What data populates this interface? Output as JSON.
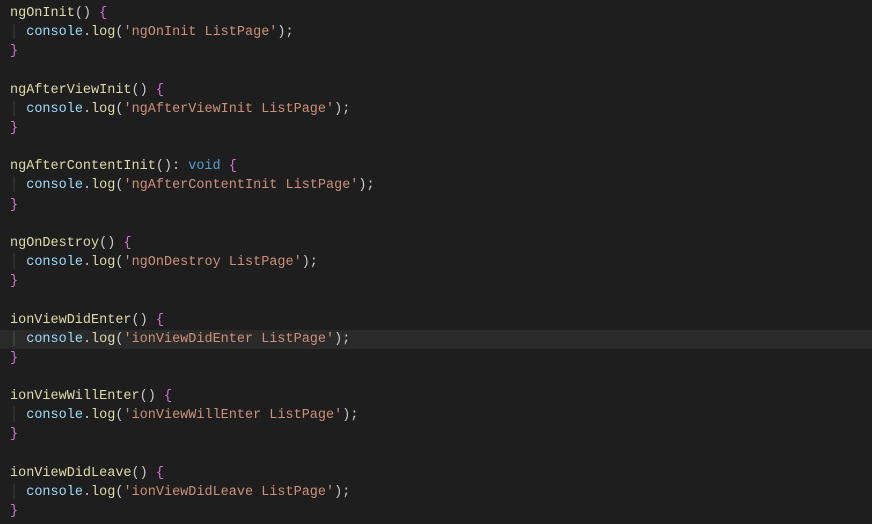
{
  "editor": {
    "methods": [
      {
        "name": "ngOnInit",
        "returnType": "",
        "highlighted": false,
        "logMessage": "ngOnInit ListPage"
      },
      {
        "name": "ngAfterViewInit",
        "returnType": "",
        "highlighted": false,
        "logMessage": "ngAfterViewInit ListPage"
      },
      {
        "name": "ngAfterContentInit",
        "returnType": "void",
        "highlighted": false,
        "logMessage": "ngAfterContentInit ListPage"
      },
      {
        "name": "ngOnDestroy",
        "returnType": "",
        "highlighted": false,
        "logMessage": "ngOnDestroy ListPage"
      },
      {
        "name": "ionViewDidEnter",
        "returnType": "",
        "highlighted": true,
        "logMessage": "ionViewDidEnter ListPage"
      },
      {
        "name": "ionViewWillEnter",
        "returnType": "",
        "highlighted": false,
        "logMessage": "ionViewWillEnter ListPage"
      },
      {
        "name": "ionViewDidLeave",
        "returnType": "",
        "highlighted": false,
        "logMessage": "ionViewDidLeave ListPage"
      }
    ],
    "consoleObj": "console",
    "logFn": "log"
  }
}
